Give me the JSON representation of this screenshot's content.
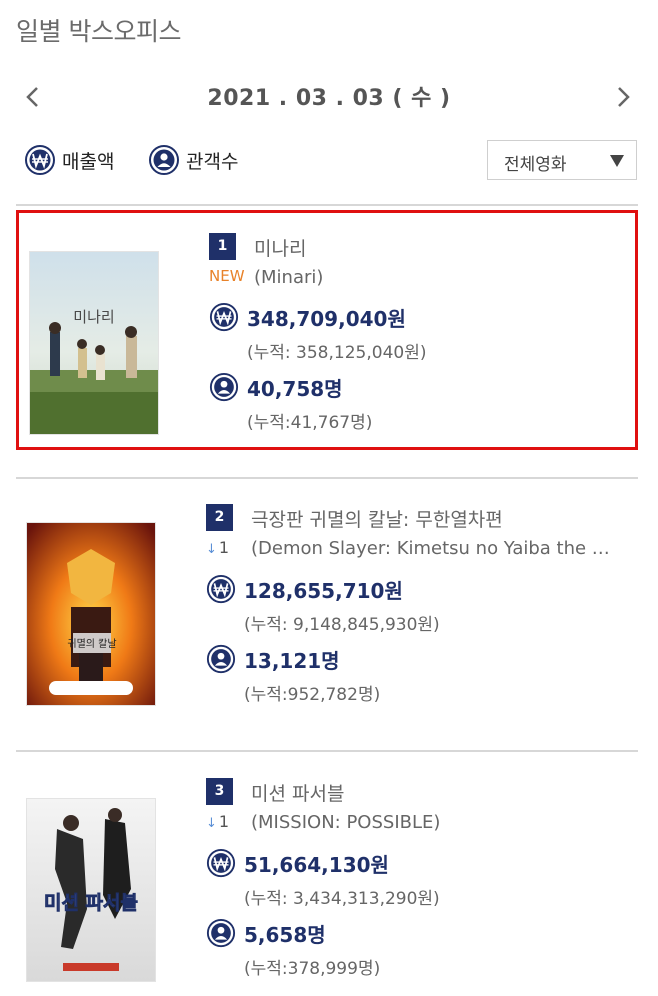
{
  "header": {
    "title": "일별 박스오피스"
  },
  "date": {
    "label": "2021 . 03 . 03 ( 수 )"
  },
  "toggles": {
    "sales_label": "매출액",
    "audience_label": "관객수"
  },
  "select": {
    "value": "전체영화"
  },
  "colors": {
    "accent": "#1f3069",
    "highlight": "#e01010",
    "new": "#e8822a",
    "arrow": "#5a8fd6"
  },
  "movies": [
    {
      "rank": "1",
      "title": "미나리",
      "change": "NEW",
      "original_title": "(Minari)",
      "sales": "348,709,040원",
      "sales_cum": "(누적: 358,125,040원)",
      "audience": "40,758명",
      "audience_cum": "(누적:41,767명)",
      "poster_text": "미나리"
    },
    {
      "rank": "2",
      "title": "극장판 귀멸의 칼날: 무한열차편",
      "change": "1",
      "original_title": "(Demon Slayer: Kimetsu no Yaiba the …",
      "sales": "128,655,710원",
      "sales_cum": "(누적: 9,148,845,930원)",
      "audience": "13,121명",
      "audience_cum": "(누적:952,782명)",
      "poster_text": "귀멸의 칼날"
    },
    {
      "rank": "3",
      "title": "미션 파서블",
      "change": "1",
      "original_title": "(MISSION: POSSIBLE)",
      "sales": "51,664,130원",
      "sales_cum": "(누적: 3,434,313,290원)",
      "audience": "5,658명",
      "audience_cum": "(누적:378,999명)",
      "poster_text": "미션 파서블"
    }
  ]
}
